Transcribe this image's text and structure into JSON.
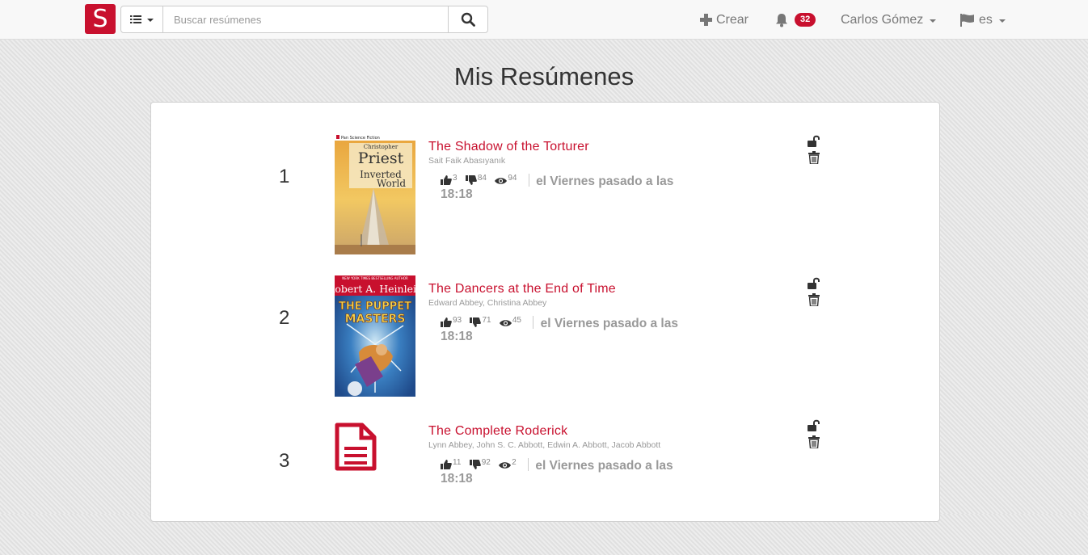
{
  "nav": {
    "logo_letter": "S",
    "search_placeholder": "Buscar resúmenes",
    "create_label": "Crear",
    "notification_count": "32",
    "user_name": "Carlos Gómez",
    "language": "es"
  },
  "page": {
    "title": "Mis Resúmenes"
  },
  "summaries": [
    {
      "index": "1",
      "title": "The Shadow of the Torturer",
      "authors": "Sait Faik Abasıyanık",
      "likes": "3",
      "dislikes": "84",
      "views": "94",
      "date_line1": "el Viernes pasado a las",
      "date_line2": "18:18",
      "cover": {
        "kind": "image",
        "publisher_strip": "Pan Science Fiction",
        "author_line1": "Christopher",
        "author_line2": "Priest",
        "title_line1": "Inverted",
        "title_line2": "World"
      }
    },
    {
      "index": "2",
      "title": "The Dancers at the End of Time",
      "authors": "Edward Abbey, Christina Abbey",
      "likes": "93",
      "dislikes": "71",
      "views": "45",
      "date_line1": "el Viernes pasado a las",
      "date_line2": "18:18",
      "cover": {
        "kind": "image",
        "top_strip": "NEW YORK TIMES BESTSELLING AUTHOR",
        "author": "Robert A. Heinlein",
        "title_line1": "THE PUPPET",
        "title_line2": "MASTERS"
      }
    },
    {
      "index": "3",
      "title": "The Complete Roderick",
      "authors": "Lynn Abbey, John S. C. Abbott, Edwin A. Abbott, Jacob Abbott",
      "likes": "11",
      "dislikes": "92",
      "views": "2",
      "date_line1": "el Viernes pasado a las",
      "date_line2": "18:18",
      "cover": {
        "kind": "document-icon"
      }
    }
  ],
  "colors": {
    "brand": "#c8102e",
    "page_bg": "#e4e4e4",
    "navbar_bg": "#f8f8f8"
  }
}
